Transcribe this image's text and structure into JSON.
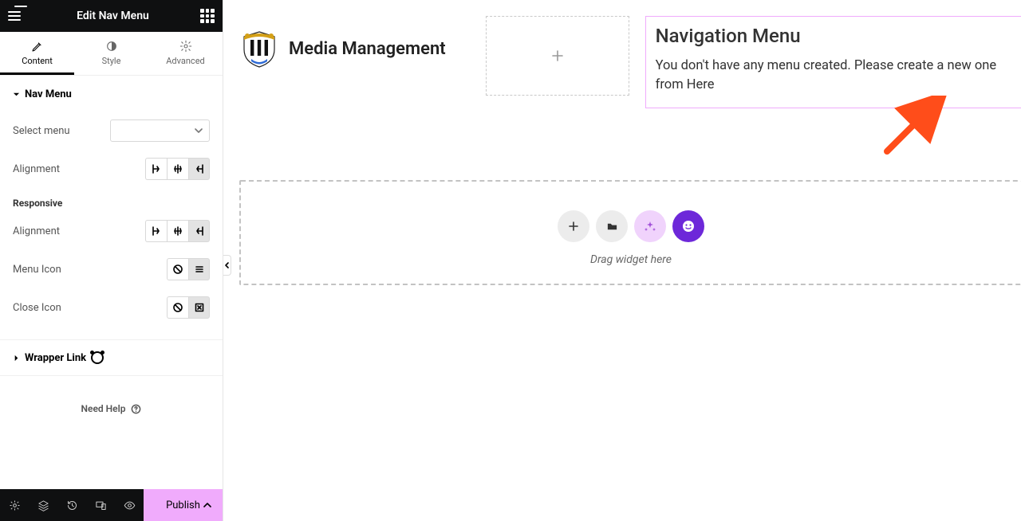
{
  "header": {
    "title": "Edit Nav Menu"
  },
  "tabs": {
    "content": "Content",
    "style": "Style",
    "advanced": "Advanced"
  },
  "section": {
    "title": "Nav Menu",
    "select_label": "Select menu",
    "align_label": "Alignment",
    "responsive_head": "Responsive",
    "menu_icon_label": "Menu Icon",
    "close_icon_label": "Close Icon"
  },
  "wrapper": {
    "title": "Wrapper Link"
  },
  "help": {
    "label": "Need Help"
  },
  "footer": {
    "publish": "Publish"
  },
  "canvas": {
    "brand": "Media Management",
    "nav_title": "Navigation Menu",
    "nav_msg": "You don't have any menu created. Please create a new one from ",
    "nav_link": "Here",
    "drop": "Drag widget here"
  }
}
